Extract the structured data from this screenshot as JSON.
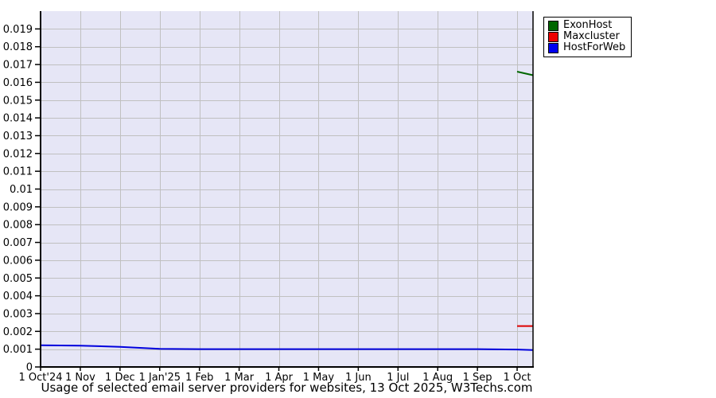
{
  "page": {
    "background": "#ffffff"
  },
  "chart_data": {
    "type": "line",
    "title": "Usage of selected email server providers for websites, 13 Oct 2025, W3Techs.com",
    "xlabel": "",
    "ylabel": "",
    "x_tick_labels": [
      "1 Oct'24",
      "1 Nov",
      "1 Dec",
      "1 Jan'25",
      "1 Feb",
      "1 Mar",
      "1 Apr",
      "1 May",
      "1 Jun",
      "1 Jul",
      "1 Aug",
      "1 Sep",
      "1 Oct"
    ],
    "y_tick_labels": [
      "0",
      "0.001",
      "0.002",
      "0.003",
      "0.004",
      "0.005",
      "0.006",
      "0.007",
      "0.008",
      "0.009",
      "0.01",
      "0.011",
      "0.012",
      "0.013",
      "0.014",
      "0.015",
      "0.016",
      "0.017",
      "0.018",
      "0.019"
    ],
    "ylim": [
      0,
      0.02
    ],
    "ytick_step": 0.001,
    "grid": true,
    "legend_position": "top-right-outside",
    "colors": {
      "plot_background": "#e6e6f6",
      "grid": "#c0c0c0",
      "axis": "#000000"
    },
    "x_axis_note": "x = month index, 0 = 1 Oct'24, 12 = 1 Oct'25, 12.4 = 13 Oct'25 (right edge)",
    "series": [
      {
        "name": "ExonHost",
        "color": "#006600",
        "points": [
          {
            "x": 12,
            "y": 0.0166
          },
          {
            "x": 12.4,
            "y": 0.0164
          }
        ]
      },
      {
        "name": "Maxcluster",
        "color": "#dd0000",
        "points": [
          {
            "x": 12,
            "y": 0.0023
          },
          {
            "x": 12.4,
            "y": 0.0023
          }
        ]
      },
      {
        "name": "HostForWeb",
        "color": "#0000dd",
        "points": [
          {
            "x": 0,
            "y": 0.00122
          },
          {
            "x": 1,
            "y": 0.0012
          },
          {
            "x": 2,
            "y": 0.00113
          },
          {
            "x": 3,
            "y": 0.00102
          },
          {
            "x": 4,
            "y": 0.001
          },
          {
            "x": 5,
            "y": 0.001
          },
          {
            "x": 6,
            "y": 0.001
          },
          {
            "x": 7,
            "y": 0.001
          },
          {
            "x": 8,
            "y": 0.001
          },
          {
            "x": 9,
            "y": 0.001
          },
          {
            "x": 10,
            "y": 0.001
          },
          {
            "x": 11,
            "y": 0.001
          },
          {
            "x": 12,
            "y": 0.00098
          },
          {
            "x": 12.4,
            "y": 0.00095
          }
        ]
      }
    ]
  },
  "legend": {
    "items": [
      {
        "label": "ExonHost",
        "color": "#006600"
      },
      {
        "label": "Maxcluster",
        "color": "#ee0000"
      },
      {
        "label": "HostForWeb",
        "color": "#0000ee"
      }
    ]
  },
  "footer": {
    "title": "Usage of selected email server providers for websites, 13 Oct 2025, W3Techs.com"
  }
}
